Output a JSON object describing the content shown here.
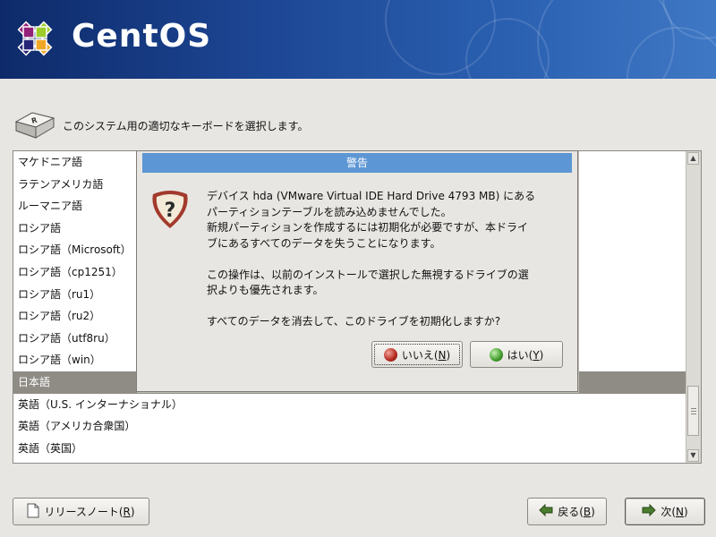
{
  "header": {
    "logo_text": "CentOS"
  },
  "instruction": "このシステム用の適切なキーボードを選択します。",
  "keyboard_list": {
    "items": [
      "マケドニア語",
      "ラテンアメリカ語",
      "ルーマニア語",
      "ロシア語",
      "ロシア語（Microsoft）",
      "ロシア語（cp1251）",
      "ロシア語（ru1）",
      "ロシア語（ru2）",
      "ロシア語（utf8ru）",
      "ロシア語（win）",
      "日本語",
      "英語（U.S. インターナショナル）",
      "英語（アメリカ合衆国）",
      "英語（英国）"
    ],
    "selected": "日本語"
  },
  "dialog": {
    "title": "警告",
    "lines": [
      "デバイス hda (VMware Virtual IDE Hard Drive 4793 MB) にある",
      "パーティションテーブルを読み込めませんでした。",
      "新規パーティションを作成するには初期化が必要ですが、本ドライ",
      "ブにあるすべてのデータを失うことになります。",
      "",
      "この操作は、以前のインストールで選択した無視するドライブの選",
      "択よりも優先されます。",
      "",
      "すべてのデータを消去して、このドライブを初期化しますか?"
    ],
    "no_button": {
      "label": "いいえ(",
      "key": "N",
      "close": ")"
    },
    "yes_button": {
      "label": "はい(",
      "key": "Y",
      "close": ")"
    }
  },
  "buttons": {
    "release_notes": {
      "label": "リリースノート(",
      "key": "R",
      "close": ")"
    },
    "back": {
      "label": "戻る(",
      "key": "B",
      "close": ")"
    },
    "next": {
      "label": "次(",
      "key": "N",
      "close": ")"
    }
  },
  "colors": {
    "selection": "#8f8c86",
    "dialog_title": "#5d96d4",
    "banner": "#1c4592"
  }
}
